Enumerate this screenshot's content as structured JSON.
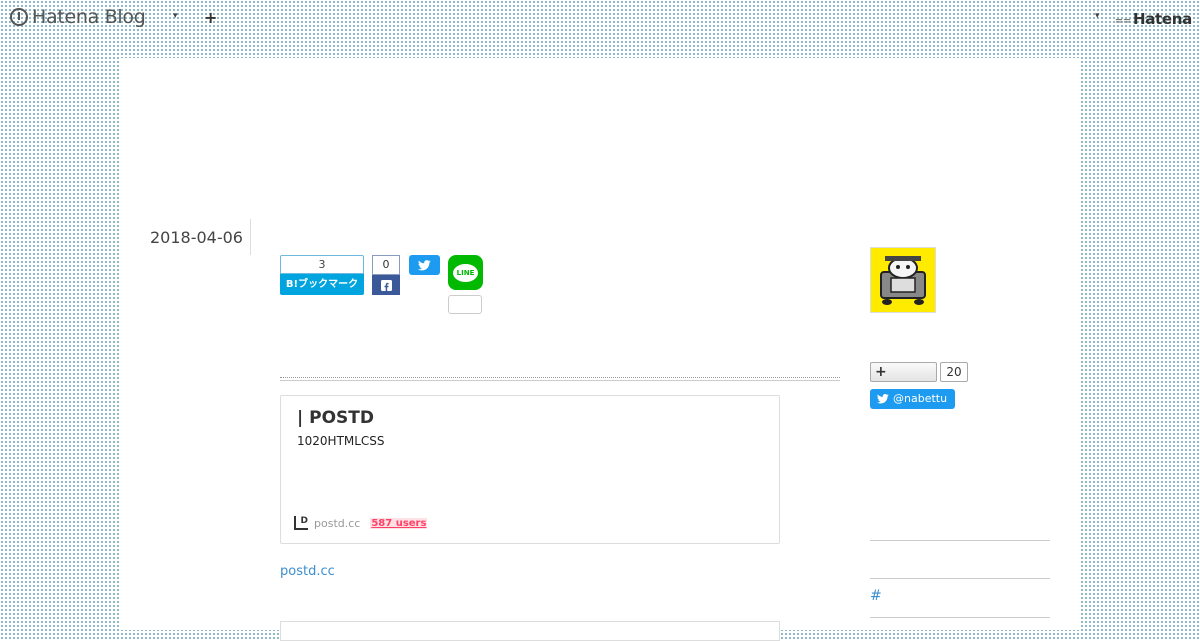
{
  "topbar": {
    "logo_text": "Hatena Blog",
    "caret": "▾",
    "plus": "+",
    "hatena_label": "Hatena",
    "hatena_lines": "=="
  },
  "entry": {
    "date": "2018-04-06"
  },
  "share": {
    "hatebu_count": "3",
    "hatebu_label": "B!ブックマーク",
    "facebook_count": "0",
    "line_label": "LINE"
  },
  "embed": {
    "title": "| POSTD",
    "description": "1020HTMLCSS",
    "domain": "postd.cc",
    "users": "587 users"
  },
  "link_text": "postd.cc",
  "sidebar": {
    "follow_plus": "+",
    "follow_count": "20",
    "twitter_handle": "@nabettu",
    "hash": "#"
  },
  "colors": {
    "hatebu": "#00a4de",
    "facebook": "#3b5998",
    "twitter": "#1d9bf0",
    "line": "#00b900",
    "link": "#3b8ecf",
    "users_badge": "#ff4166"
  }
}
